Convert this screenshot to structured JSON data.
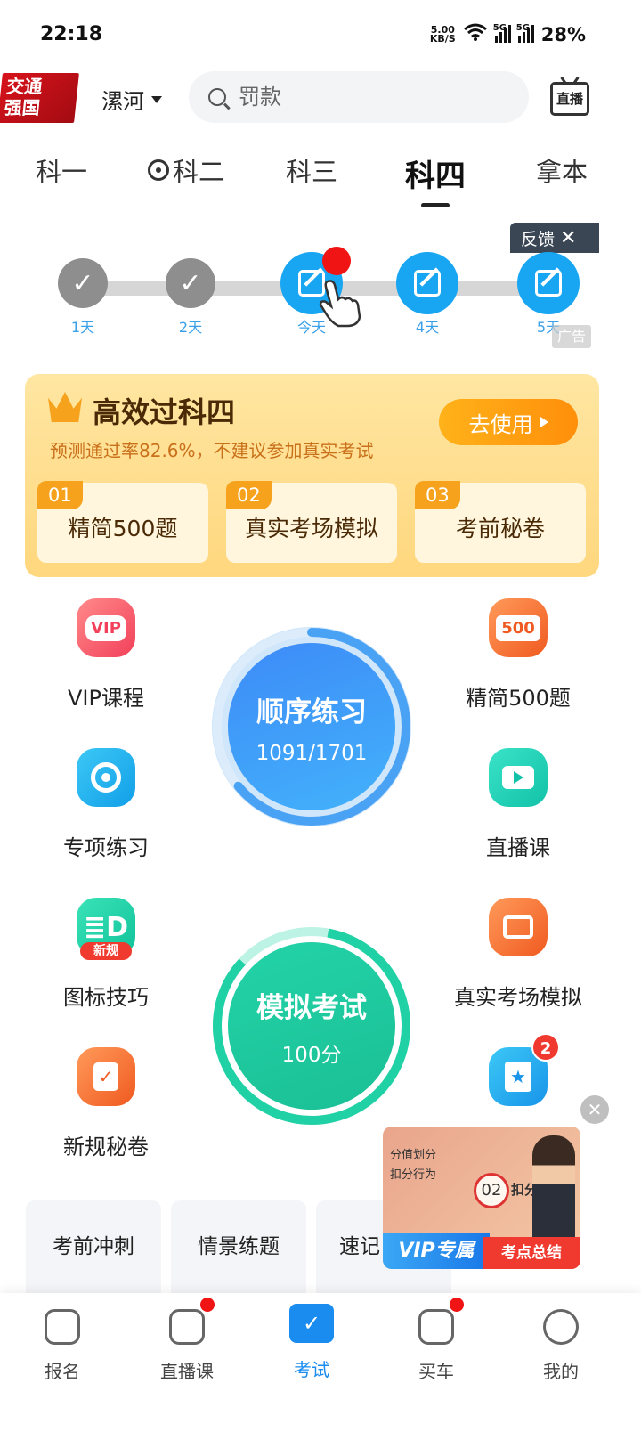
{
  "status_bar": {
    "time": "22:18",
    "net_speed": "5.00\nKB/S",
    "sim1": "5G",
    "sim2": "5G",
    "battery": "28%"
  },
  "header": {
    "logo_text": "交通\n强国",
    "city": "漯河",
    "search_placeholder": "罚款",
    "live_label": "直播"
  },
  "tabs": [
    "科一",
    "科二",
    "科三",
    "科四",
    "拿本"
  ],
  "active_tab": "科四",
  "days": {
    "labels": [
      "1天",
      "2天",
      "今天",
      "4天",
      "5天"
    ],
    "feedback": "反馈",
    "ad_label": "广告"
  },
  "promo": {
    "title": "高效过科四",
    "subtitle": "预测通过率82.6%，不建议参加真实考试",
    "button": "去使用",
    "cards": [
      {
        "num": "01",
        "label": "精简500题"
      },
      {
        "num": "02",
        "label": "真实考场模拟"
      },
      {
        "num": "03",
        "label": "考前秘卷"
      }
    ]
  },
  "features": {
    "vip": {
      "label": "VIP课程",
      "icon_text": "VIP"
    },
    "q500": {
      "label": "精简500题",
      "icon_text": "500"
    },
    "special": {
      "label": "专项练习"
    },
    "live": {
      "label": "直播课"
    },
    "signs": {
      "label": "图标技巧",
      "tag": "新规"
    },
    "realsim": {
      "label": "真实考场模拟"
    },
    "newpaper": {
      "label": "新规秘卷"
    },
    "fav": {
      "badge": "2"
    }
  },
  "practice": {
    "title": "顺序练习",
    "progress": "1091/1701",
    "done": 1091,
    "total": 1701
  },
  "mock": {
    "title": "模拟考试",
    "score": "100分"
  },
  "cards": [
    "考前冲刺",
    "情景练题",
    "速记"
  ],
  "video": {
    "line1": "分值划分",
    "line2": "扣分行为",
    "circle": "02",
    "keyword": "扣分分值",
    "vip": "VIP专属",
    "summary": "考点总结"
  },
  "bottom_nav": [
    "报名",
    "直播课",
    "考试",
    "买车",
    "我的"
  ],
  "colors": {
    "accent": "#1a8cf0",
    "promo": "#ffd77e",
    "red": "#f01414"
  }
}
